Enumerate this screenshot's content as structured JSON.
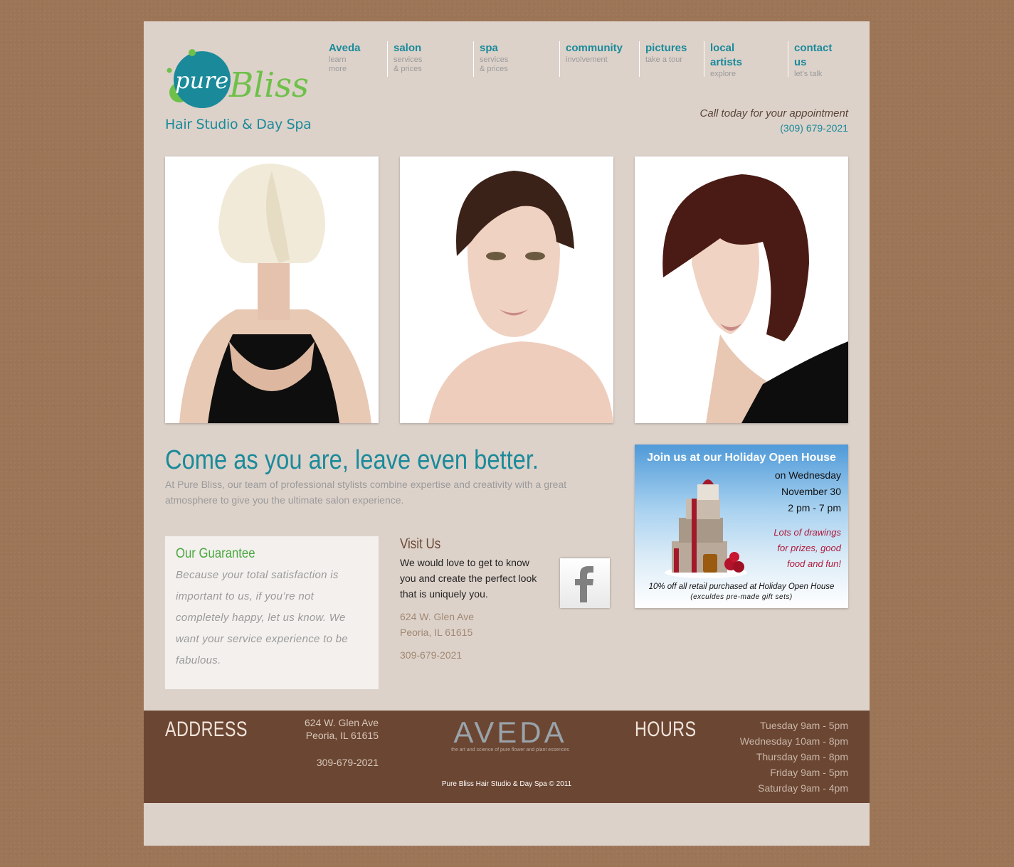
{
  "brand": {
    "logo_word1": "pure",
    "logo_word2": "Bliss",
    "subtitle": "Hair Studio & Day Spa"
  },
  "nav": [
    {
      "title": "Aveda",
      "sub": "learn more"
    },
    {
      "title": "salon",
      "sub": "services & prices"
    },
    {
      "title": "spa",
      "sub": "services & prices"
    },
    {
      "title": "community",
      "sub": "involvement"
    },
    {
      "title": "pictures",
      "sub": "take a tour"
    },
    {
      "title": "local artists",
      "sub": "explore"
    },
    {
      "title": "contact us",
      "sub": "let's talk"
    }
  ],
  "call": {
    "text": "Call today for your appointment",
    "phone": "(309) 679-2021"
  },
  "main": {
    "tagline": "Come as you are, leave even better.",
    "intro": "At Pure Bliss, our team of professional stylists combine expertise and creativity with a great atmosphere to give you the ultimate salon experience."
  },
  "guarantee": {
    "title": "Our Guarantee",
    "text": "Because your total satisfaction is important to us, if you’re not completely happy, let us know. We want your service experience to be fabulous."
  },
  "visit": {
    "title": "Visit Us",
    "text": "We would love to get to know you and create the perfect look that is uniquely you.",
    "address_line1": "624 W. Glen Ave",
    "address_line2": "Peoria, IL 61615",
    "phone": "309-679-2021"
  },
  "promo": {
    "title": "Join us at our Holiday Open House",
    "line1": "on Wednesday",
    "line2": "November 30",
    "line3": "2 pm - 7 pm",
    "red1": "Lots of drawings",
    "red2": "for prizes, good",
    "red3": "food and fun!",
    "offer": "10% off all retail purchased at Holiday Open House",
    "exclusion": "(exculdes pre-made gift sets)"
  },
  "footer": {
    "address_label": "ADDRESS",
    "address_line1": "624 W. Glen Ave",
    "address_line2": "Peoria, IL 61615",
    "phone": "309-679-2021",
    "aveda_logo": "AVEDA",
    "aveda_tagline": "the art and science of pure flower and plant essences",
    "copyright": "Pure Bliss Hair Studio & Day Spa © 2011",
    "hours_label": "HOURS",
    "hours": [
      "Tuesday 9am - 5pm",
      "Wednesday 10am - 8pm",
      "Thursday 9am - 8pm",
      "Friday 9am - 5pm",
      "Saturday 9am - 4pm"
    ]
  },
  "colors": {
    "teal": "#1a8a9a",
    "green": "#4aa83e",
    "brown": "#6b4633",
    "page_bg": "#ddd2ca",
    "outer_bg": "#9c7557"
  }
}
